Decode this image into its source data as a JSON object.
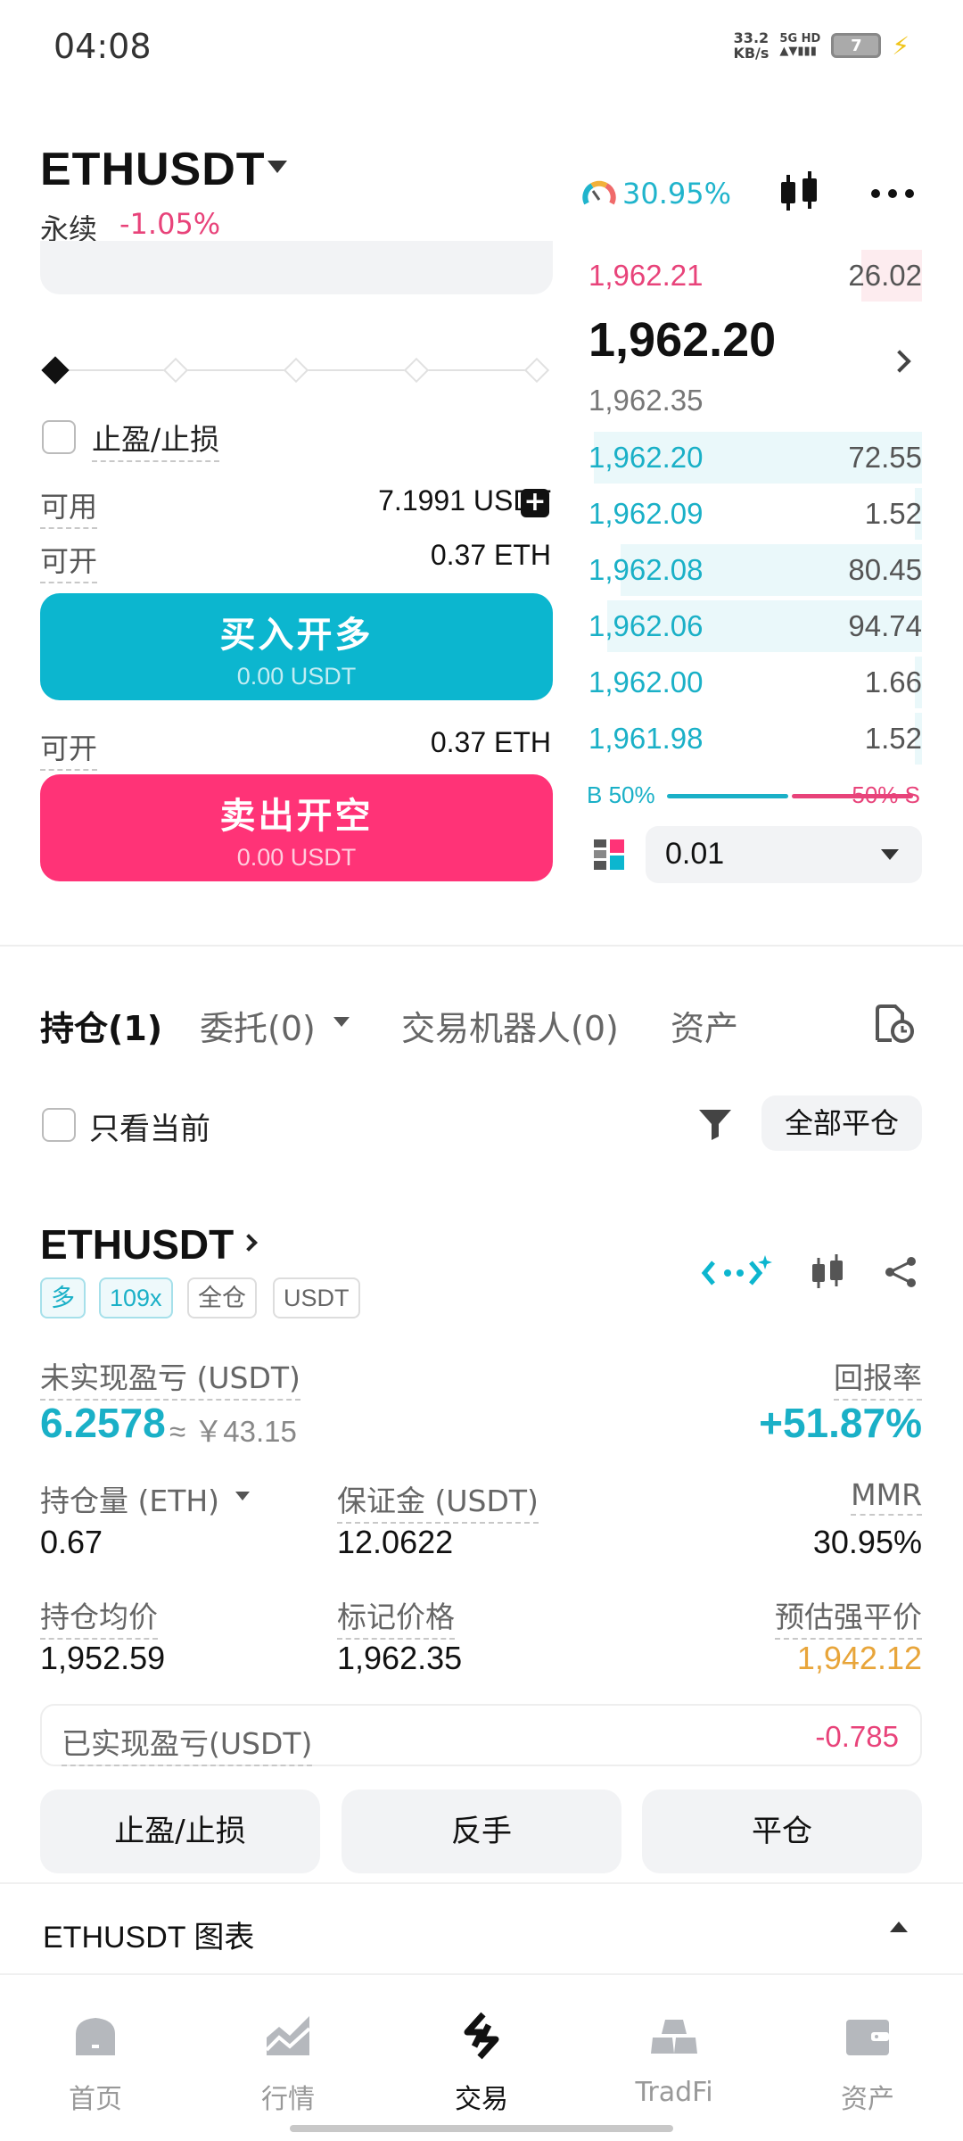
{
  "status": {
    "time": "04:08",
    "net_speed_value": "33.2",
    "net_speed_unit": "KB/s",
    "signal_label": "5G HD",
    "battery": "7"
  },
  "header": {
    "pair": "ETHUSDT",
    "contract_type": "永续",
    "change": "-1.05%",
    "risk_rate": "30.95%"
  },
  "order_form": {
    "tp_sl_label": "止盈/止损",
    "available_label": "可用",
    "available_value": "7.1991 USDT",
    "open_label": "可开",
    "open_long_value": "0.37 ETH",
    "open_short_value": "0.37 ETH",
    "buy_label": "买入开多",
    "buy_amount": "0.00 USDT",
    "sell_label": "卖出开空",
    "sell_amount": "0.00 USDT"
  },
  "order_book": {
    "asks": [
      {
        "price": "1,962.21",
        "qty": "26.02",
        "depth": 0.18
      }
    ],
    "last_price": "1,962.20",
    "mark_price": "1,962.35",
    "bids": [
      {
        "price": "1,962.20",
        "qty": "72.55",
        "depth": 0.98
      },
      {
        "price": "1,962.09",
        "qty": "1.52",
        "depth": 0.02
      },
      {
        "price": "1,962.08",
        "qty": "80.45",
        "depth": 0.9
      },
      {
        "price": "1,962.06",
        "qty": "94.74",
        "depth": 0.94
      },
      {
        "price": "1,962.00",
        "qty": "1.66",
        "depth": 0.02
      },
      {
        "price": "1,961.98",
        "qty": "1.52",
        "depth": 0.02
      }
    ],
    "buy_ratio": "B 50%",
    "sell_ratio": "50% S",
    "precision": "0.01"
  },
  "tabs": {
    "positions": "持仓(1)",
    "orders": "委托(0)",
    "bots": "交易机器人(0)",
    "assets": "资产"
  },
  "filter": {
    "current_only": "只看当前",
    "close_all": "全部平仓"
  },
  "position": {
    "symbol": "ETHUSDT",
    "tags": [
      "多",
      "109x",
      "全仓",
      "USDT"
    ],
    "upnl_label": "未实现盈亏 (USDT)",
    "upnl_value": "6.2578",
    "upnl_cny": "≈ ￥43.15",
    "roe_label": "回报率",
    "roe_value": "+51.87%",
    "size_label": "持仓量 (ETH)",
    "size_value": "0.67",
    "margin_label": "保证金 (USDT)",
    "margin_value": "12.0622",
    "mmr_label": "MMR",
    "mmr_value": "30.95%",
    "entry_label": "持仓均价",
    "entry_value": "1,952.59",
    "mark_label": "标记价格",
    "mark_value": "1,962.35",
    "liq_label": "预估强平价",
    "liq_value": "1,942.12",
    "realized_label": "已实现盈亏(USDT)",
    "realized_value": "-0.785",
    "btn_tpsl": "止盈/止损",
    "btn_reverse": "反手",
    "btn_close": "平仓"
  },
  "chart_section": {
    "label": "ETHUSDT 图表"
  },
  "nav": {
    "home": "首页",
    "markets": "行情",
    "trade": "交易",
    "tradfi": "TradFi",
    "assets": "资产"
  },
  "colors": {
    "accent_cyan": "#0cb6cf",
    "accent_pink": "#ff3377",
    "liq_orange": "#e8a53a"
  }
}
